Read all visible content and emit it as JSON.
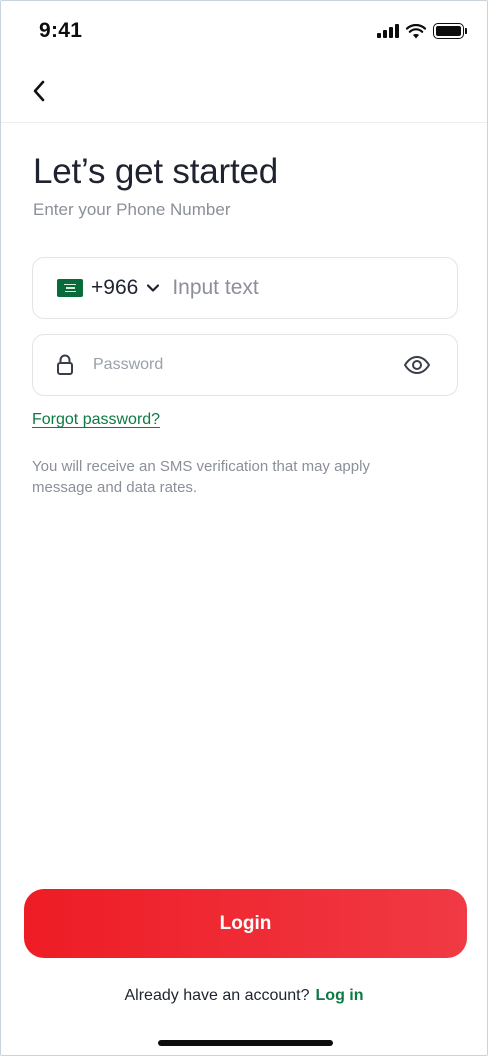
{
  "status_bar": {
    "time": "9:41"
  },
  "header": {
    "title": "Let’s get started",
    "subtitle": "Enter your Phone Number"
  },
  "phone": {
    "country_flag": "saudi-arabia-flag",
    "country_code": "+966",
    "placeholder": "Input text"
  },
  "password": {
    "placeholder": "Password"
  },
  "forgot_password_label": "Forgot password?",
  "sms_note": "You will receive an SMS verification that may apply message and data rates.",
  "login_button_label": "Login",
  "footer": {
    "prompt": "Already have an account?",
    "link_label": "Log in"
  },
  "colors": {
    "primary_red": "#ee1c25",
    "link_green": "#0e7a43",
    "flag_green": "#0a6b3a"
  }
}
